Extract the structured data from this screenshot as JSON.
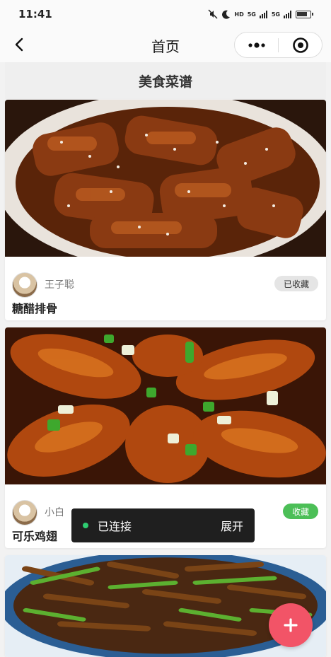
{
  "status_bar": {
    "time": "11:41",
    "indicators": [
      "hd-indicator",
      "5g-signal-1",
      "5g-signal-2"
    ],
    "labels": [
      "HD",
      "5G",
      "5G"
    ]
  },
  "nav": {
    "title": "首页",
    "back_icon": "chevron-left-icon",
    "more_icon": "more-dots-icon",
    "close_icon": "target-icon"
  },
  "section": {
    "title": "美食菜谱"
  },
  "cards": [
    {
      "author": "王子聪",
      "dish": "糖醋排骨",
      "favorite": "已收藏",
      "favorited": true
    },
    {
      "author": "小白",
      "dish": "可乐鸡翅",
      "favorite": "收藏",
      "favorited": false
    },
    {
      "dish_partial": true
    }
  ],
  "toast": {
    "status": "已连接",
    "action": "展开"
  },
  "fab": {
    "icon": "plus-icon"
  },
  "colors": {
    "accent_green": "#4cbf57",
    "fab_red": "#f25467",
    "toast_bg": "#1f1f1f"
  }
}
